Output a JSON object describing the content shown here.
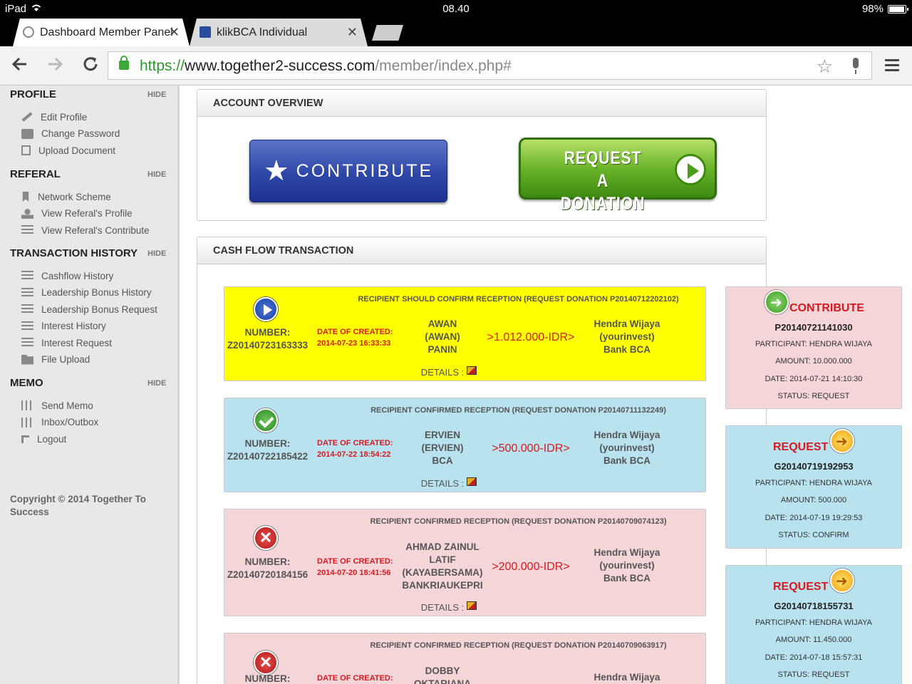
{
  "statusbar": {
    "device": "iPad",
    "time": "08.40",
    "battery": "98%",
    "battery_level": 0.98
  },
  "tabs": [
    {
      "title": "Dashboard Member Panel",
      "close": "✕"
    },
    {
      "title": "klikBCA Individual",
      "close": "✕"
    }
  ],
  "toolbar": {
    "url_scheme": "https://",
    "url_host": "www.together2-success.com",
    "url_path": "/member/index.php#"
  },
  "sidebar": {
    "hide_label": "HIDE",
    "sections": [
      {
        "title": "PROFILE",
        "items": [
          {
            "label": "Edit Profile",
            "icon": "pencil-icon"
          },
          {
            "label": "Change Password",
            "icon": "lock-icon"
          },
          {
            "label": "Upload Document",
            "icon": "document-upload-icon"
          }
        ]
      },
      {
        "title": "REFERAL",
        "items": [
          {
            "label": "Network Scheme",
            "icon": "bookmark-icon"
          },
          {
            "label": "View Referal's Profile",
            "icon": "user-icon"
          },
          {
            "label": "View Referal's Contribute",
            "icon": "list-icon"
          }
        ]
      },
      {
        "title": "TRANSACTION HISTORY",
        "items": [
          {
            "label": "Cashflow History",
            "icon": "list-icon"
          },
          {
            "label": "Leadership Bonus History",
            "icon": "list-icon"
          },
          {
            "label": "Leadership Bonus Request",
            "icon": "list-icon"
          },
          {
            "label": "Interest History",
            "icon": "list-icon"
          },
          {
            "label": "Interest Request",
            "icon": "list-icon"
          },
          {
            "label": "File Upload",
            "icon": "folder-icon"
          }
        ]
      },
      {
        "title": "MEMO",
        "items": [
          {
            "label": "Send Memo",
            "icon": "sliders-icon"
          },
          {
            "label": "Inbox/Outbox",
            "icon": "sliders-icon"
          },
          {
            "label": "Logout",
            "icon": "arrow-icon"
          }
        ]
      }
    ],
    "copyright": "Copyright © 2014 Together To Success"
  },
  "overview": {
    "title": "ACCOUNT OVERVIEW",
    "contribute_label": "CONTRIBUTE",
    "request_label_1": "REQUEST A",
    "request_label_2": "DONATION"
  },
  "cashflow": {
    "title": "CASH FLOW TRANSACTION",
    "transactions": [
      {
        "caption": "RECIPIENT SHOULD CONFIRM RECEPTION (REQUEST DONATION P20140712202102)",
        "number_label": "NUMBER:",
        "number": "Z20140723163333",
        "date_label": "DATE OF CREATED:",
        "date": "2014-07-23 16:33:33",
        "sender": [
          "AWAN",
          "(AWAN)",
          "PANIN"
        ],
        "amount": ">1.012.000-IDR>",
        "recipient": [
          "Hendra Wijaya",
          "(yourinvest)",
          "Bank BCA"
        ],
        "details": "DETAILS :"
      },
      {
        "caption": "RECIPIENT CONFIRMED RECEPTION (REQUEST DONATION P20140711132249)",
        "number_label": "NUMBER:",
        "number": "Z20140722185422",
        "date_label": "DATE OF CREATED:",
        "date": "2014-07-22 18:54:22",
        "sender": [
          "ERVIEN",
          "(ERVIEN)",
          "BCA"
        ],
        "amount": ">500.000-IDR>",
        "recipient": [
          "Hendra Wijaya",
          "(yourinvest)",
          "Bank BCA"
        ],
        "details": "DETAILS :"
      },
      {
        "caption": "RECIPIENT CONFIRMED RECEPTION (REQUEST DONATION P20140709074123)",
        "number_label": "NUMBER:",
        "number": "Z20140720184156",
        "date_label": "DATE OF CREATED:",
        "date": "2014-07-20 18:41:56",
        "sender": [
          "AHMAD ZAINUL",
          "LATIF",
          "(KAYABERSAMA)",
          "BANKRIAUKEPRI"
        ],
        "amount": ">200.000-IDR>",
        "recipient": [
          "Hendra Wijaya",
          "(yourinvest)",
          "Bank BCA"
        ],
        "details": "DETAILS :"
      },
      {
        "caption": "RECIPIENT CONFIRMED RECEPTION (REQUEST DONATION P20140709063917)",
        "number_label": "NUMBER:",
        "date_label": "DATE OF CREATED:",
        "sender": [
          "DOBBY",
          "OKTARIANA"
        ],
        "recipient": [
          "Hendra Wijaya"
        ]
      }
    ]
  },
  "side_cards": [
    {
      "type": "CONTRIBUTE",
      "id": "P20140721141030",
      "participant": "PARTICIPANT: HENDRA WIJAYA",
      "amount": "AMOUNT: 10.000.000",
      "date": "DATE: 2014-07-21 14:10:30",
      "status": "STATUS: REQUEST"
    },
    {
      "type": "REQUEST",
      "id": "G20140719192953",
      "participant": "PARTICIPANT: HENDRA WIJAYA",
      "amount": "AMOUNT: 500.000",
      "date": "DATE: 2014-07-19 19:29:53",
      "status": "STATUS: CONFIRM"
    },
    {
      "type": "REQUEST",
      "id": "G20140718155731",
      "participant": "PARTICIPANT: HENDRA WIJAYA",
      "amount": "AMOUNT: 11.450.000",
      "date": "DATE: 2014-07-18 15:57:31",
      "status": "STATUS: REQUEST"
    }
  ]
}
